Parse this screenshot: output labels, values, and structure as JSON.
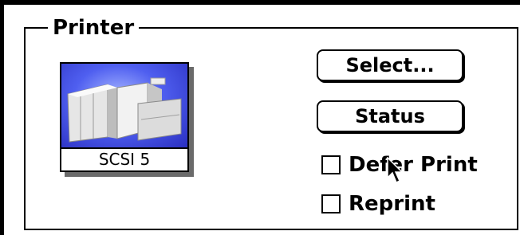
{
  "group": {
    "label": "Printer"
  },
  "printer": {
    "name": "SCSI 5",
    "icon": "printer-icon"
  },
  "buttons": {
    "select_label": "Select...",
    "status_label": "Status"
  },
  "options": {
    "defer_print": {
      "label": "Defer Print",
      "checked": false
    },
    "reprint": {
      "label": "Reprint",
      "checked": false
    }
  },
  "colors": {
    "icon_background": "#4f5ff0",
    "frame": "#000000"
  }
}
